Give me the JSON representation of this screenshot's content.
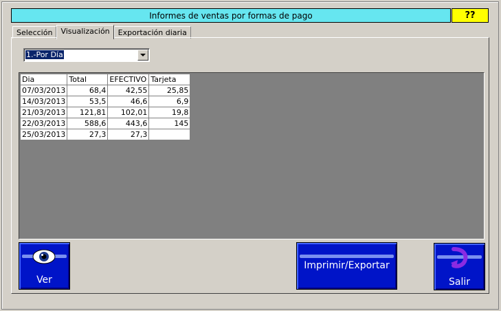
{
  "window": {
    "title": "Informes de ventas por formas de pago",
    "help_label": "??"
  },
  "tabs": [
    {
      "label": "Selección"
    },
    {
      "label": "Visualización"
    },
    {
      "label": "Exportación diaria"
    }
  ],
  "report_select": {
    "selected": "1.-Por Día"
  },
  "table": {
    "headers": [
      "Dia",
      "Total",
      "EFECTIVO",
      "Tarjeta"
    ],
    "rows": [
      [
        "07/03/2013",
        "68,4",
        "42,55",
        "25,85"
      ],
      [
        "14/03/2013",
        "53,5",
        "46,6",
        "6,9"
      ],
      [
        "21/03/2013",
        "121,81",
        "102,01",
        "19,8"
      ],
      [
        "22/03/2013",
        "588,6",
        "443,6",
        "145"
      ],
      [
        "25/03/2013",
        "27,3",
        "27,3",
        ""
      ]
    ]
  },
  "buttons": {
    "ver": "Ver",
    "imprimir": "Imprimir/Exportar",
    "salir": "Salir"
  },
  "icons": {
    "ver": "eye-icon",
    "salir": "exit-arrow-icon"
  },
  "colors": {
    "title_bg": "#66e6f0",
    "help_bg": "#ffff00",
    "button_bg": "#0014c8",
    "selection": "#0a246a"
  }
}
